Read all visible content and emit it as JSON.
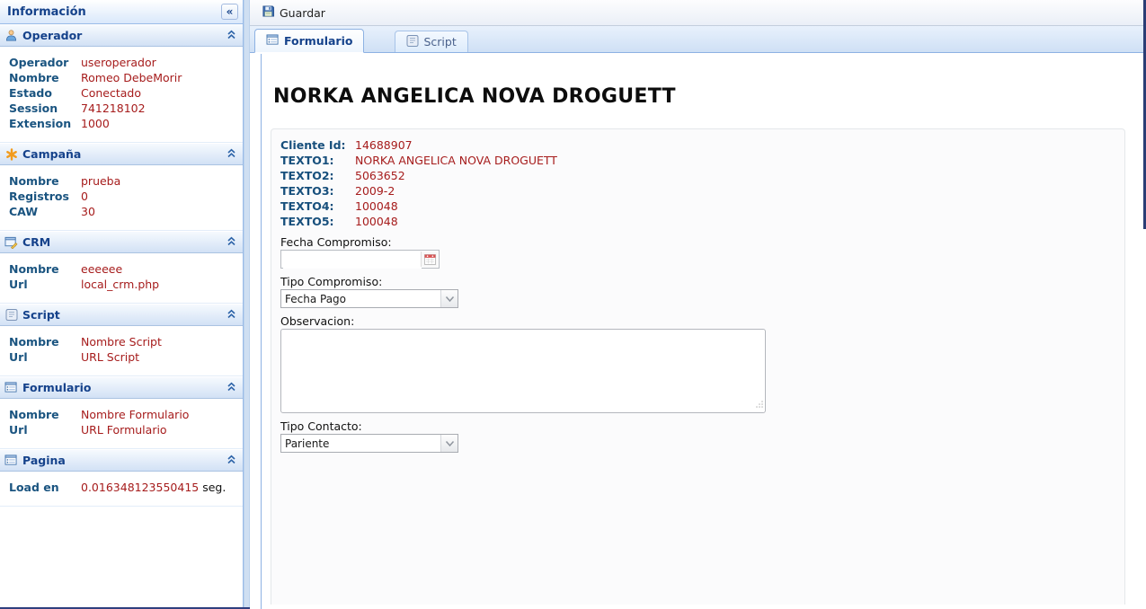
{
  "colors": {
    "accent": "#15428b",
    "label_blue": "#1a5480",
    "value_red": "#a61c1c",
    "tab_border": "#8db2e3",
    "scroll_thumb": "#2b3d75"
  },
  "sidebar": {
    "title": "Información",
    "collapse_glyph": "«",
    "sections": [
      {
        "title": "Operador",
        "icon": "user-icon",
        "rows": [
          {
            "label": "Operador",
            "value": "useroperador"
          },
          {
            "label": "Nombre",
            "value": "Romeo DebeMorir"
          },
          {
            "label": "Estado",
            "value": "Conectado"
          },
          {
            "label": "Session",
            "value": "741218102"
          },
          {
            "label": "Extension",
            "value": "1000"
          }
        ]
      },
      {
        "title": "Campaña",
        "icon": "asterisk-icon",
        "rows": [
          {
            "label": "Nombre",
            "value": "prueba"
          },
          {
            "label": "Registros",
            "value": "0"
          },
          {
            "label": "CAW",
            "value": "30"
          }
        ]
      },
      {
        "title": "CRM",
        "icon": "app-edit-icon",
        "rows": [
          {
            "label": "Nombre",
            "value": "eeeeee"
          },
          {
            "label": "Url",
            "value": "local_crm.php"
          }
        ]
      },
      {
        "title": "Script",
        "icon": "script-icon",
        "rows": [
          {
            "label": "Nombre",
            "value": "Nombre Script"
          },
          {
            "label": "Url",
            "value": "URL Script"
          }
        ]
      },
      {
        "title": "Formulario",
        "icon": "form-icon",
        "rows": [
          {
            "label": "Nombre",
            "value": "Nombre Formulario"
          },
          {
            "label": "Url",
            "value": "URL Formulario"
          }
        ]
      },
      {
        "title": "Pagina",
        "icon": "form-icon",
        "rows": [
          {
            "label": "Load en",
            "value": "0.016348123550415",
            "suffix": "seg."
          }
        ]
      }
    ]
  },
  "toolbar": {
    "save_label": "Guardar"
  },
  "tabs": [
    {
      "label": "Formulario",
      "active": true
    },
    {
      "label": "Script",
      "active": false
    }
  ],
  "form": {
    "title": "NORKA ANGELICA NOVA DROGUETT",
    "fields": [
      {
        "label": "Cliente Id:",
        "value": "14688907"
      },
      {
        "label": "TEXTO1:",
        "value": "NORKA ANGELICA NOVA DROGUETT"
      },
      {
        "label": "TEXTO2:",
        "value": "5063652"
      },
      {
        "label": "TEXTO3:",
        "value": "2009-2"
      },
      {
        "label": "TEXTO4:",
        "value": "100048"
      },
      {
        "label": "TEXTO5:",
        "value": "100048"
      }
    ],
    "fecha_compromiso": {
      "label": "Fecha Compromiso:",
      "value": ""
    },
    "tipo_compromiso": {
      "label": "Tipo Compromiso:",
      "value": "Fecha Pago"
    },
    "observacion": {
      "label": "Observacion:",
      "value": ""
    },
    "tipo_contacto": {
      "label": "Tipo Contacto:",
      "value": "Pariente"
    }
  }
}
